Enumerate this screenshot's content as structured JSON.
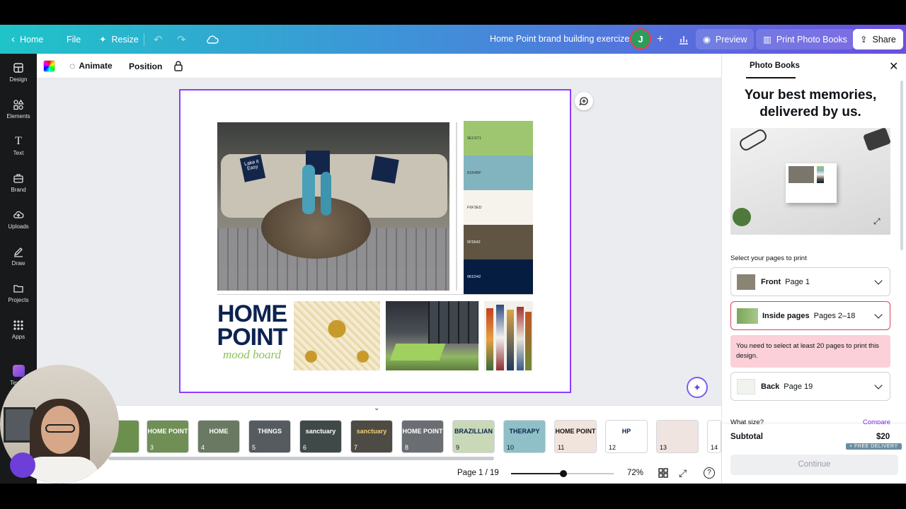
{
  "topbar": {
    "home": "Home",
    "file": "File",
    "resize": "Resize",
    "doc_title": "Home Point brand building exercizes",
    "avatar_letter": "J",
    "preview": "Preview",
    "print": "Print Photo Books",
    "share": "Share"
  },
  "toolbar": {
    "animate": "Animate",
    "position": "Position"
  },
  "rail": [
    {
      "label": "Design"
    },
    {
      "label": "Elements"
    },
    {
      "label": "Text"
    },
    {
      "label": "Brand"
    },
    {
      "label": "Uploads"
    },
    {
      "label": "Draw"
    },
    {
      "label": "Projects"
    },
    {
      "label": "Apps"
    },
    {
      "label": "Text to"
    }
  ],
  "canvas": {
    "swatches": [
      {
        "hex": "9EC671",
        "color": "#9ec671"
      },
      {
        "hex": "81B4BF",
        "color": "#81b4bf"
      },
      {
        "hex": "F6F3ED",
        "color": "#f6f3ed"
      },
      {
        "hex": "5F5542",
        "color": "#5f5542"
      },
      {
        "hex": "061D42",
        "color": "#061d42"
      }
    ],
    "logo_line1": "HOME",
    "logo_line2": "POINT",
    "logo_tag": "mood board",
    "pillow_text": "Lake it Easy"
  },
  "thumbs": [
    {
      "n": "3",
      "txt": "HOME POINT"
    },
    {
      "n": "4",
      "txt": "HOME"
    },
    {
      "n": "5",
      "txt": "THINGS"
    },
    {
      "n": "6",
      "txt": "sanctuary"
    },
    {
      "n": "7",
      "txt": "sanctuary"
    },
    {
      "n": "8",
      "txt": "HOME POINT"
    },
    {
      "n": "9",
      "txt": "BRAZILLIAN"
    },
    {
      "n": "10",
      "txt": "THERAPY"
    },
    {
      "n": "11",
      "txt": "HOME POINT"
    },
    {
      "n": "12",
      "txt": "HP"
    },
    {
      "n": "13",
      "txt": ""
    },
    {
      "n": "14",
      "txt": ""
    }
  ],
  "bottom": {
    "page_indicator": "Page 1 / 19",
    "zoom": "72%",
    "zoom_fraction": 0.51
  },
  "panel": {
    "tab": "Photo Books",
    "headline": "Your best memories, delivered by us.",
    "select_label": "Select your pages to print",
    "front": {
      "label": "Front",
      "value": "Page 1"
    },
    "inside": {
      "label": "Inside pages",
      "value": "Pages 2–18"
    },
    "warning": "You need to select at least 20 pages to print this design.",
    "back": {
      "label": "Back",
      "value": "Page 19"
    },
    "what_size": "What size?",
    "compare": "Compare",
    "subtotal_label": "Subtotal",
    "subtotal_value": "$20",
    "delivery": "+ FREE DELIVERY",
    "continue": "Continue"
  },
  "colors": {
    "accent": "#8b3dff",
    "warning_bg": "#fbd0d8",
    "error_border": "#d1435b"
  }
}
